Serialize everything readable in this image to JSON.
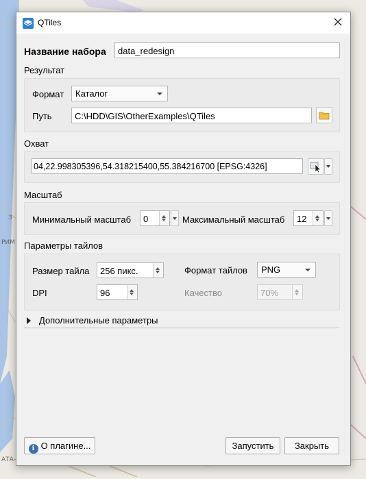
{
  "window": {
    "title": "QTiles"
  },
  "dataset": {
    "label": "Название набора",
    "value": "data_redesign"
  },
  "result": {
    "section_title": "Результат",
    "format_label": "Формат",
    "format_value": "Каталог",
    "path_label": "Путь",
    "path_value": "C:\\HDD\\GIS\\OtherExamples\\QTiles"
  },
  "extent": {
    "section_title": "Охват",
    "value": "04,22.998305396,54.318215400,55.384216700 [EPSG:4326]"
  },
  "scale": {
    "section_title": "Масштаб",
    "min_label": "Минимальный масштаб",
    "min_value": "0",
    "max_label": "Максимальный масштаб",
    "max_value": "12"
  },
  "tiles": {
    "section_title": "Параметры тайлов",
    "size_label": "Размер тайла",
    "size_value": "256 пикс.",
    "format_label": "Формат тайлов",
    "format_value": "PNG",
    "dpi_label": "DPI",
    "dpi_value": "96",
    "quality_label": "Качество",
    "quality_value": "70%"
  },
  "advanced": {
    "label": "Дополнительные параметры"
  },
  "buttons": {
    "about": "О плагине...",
    "run": "Запустить",
    "close": "Закрыть"
  },
  "map_labels": {
    "left_1": "З",
    "left_2": "РИМ",
    "bottom": "АТА-З"
  },
  "colors": {
    "water": "#a9c4e6",
    "accent": "#2f7fd0",
    "folder": "#f2c14e"
  }
}
